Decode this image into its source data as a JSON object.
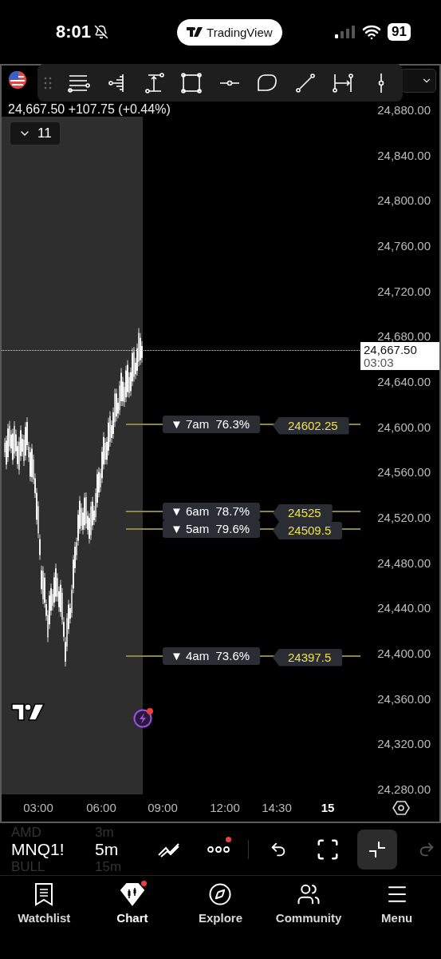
{
  "status_bar": {
    "time": "8:01",
    "app_pill": "TradingView",
    "battery": "91"
  },
  "quote": "24,667.50 +107.75 (+0.44%)",
  "indicators_toggle": {
    "count": "11",
    "expanded": false
  },
  "price_axis": {
    "labels": [
      "24,880.00",
      "24,840.00",
      "24,800.00",
      "24,760.00",
      "24,720.00",
      "24,680.00",
      "24,640.00",
      "24,600.00",
      "24,560.00",
      "24,520.00",
      "24,480.00",
      "24,440.00",
      "24,400.00",
      "24,360.00",
      "24,320.00",
      "24,280.00"
    ],
    "current_price": "24,667.50",
    "countdown": "03:03"
  },
  "levels": [
    {
      "marker": "▼",
      "session": "7am",
      "percent": "76.3%",
      "price": "24602.25"
    },
    {
      "marker": "▼",
      "session": "6am",
      "percent": "78.7%",
      "price": "24525"
    },
    {
      "marker": "▼",
      "session": "5am",
      "percent": "79.6%",
      "price": "24509.5"
    },
    {
      "marker": "▼",
      "session": "4am",
      "percent": "73.6%",
      "price": "24397.5"
    }
  ],
  "time_axis": [
    {
      "label": "03:00",
      "kind": "time"
    },
    {
      "label": "06:00",
      "kind": "time"
    },
    {
      "label": "09:00",
      "kind": "time"
    },
    {
      "label": "12:00",
      "kind": "time"
    },
    {
      "label": "14:30",
      "kind": "time"
    },
    {
      "label": "15",
      "kind": "day"
    }
  ],
  "symbol_picker": [
    {
      "symbol": "AMD",
      "interval": "3m",
      "selected": false
    },
    {
      "symbol": "MNQ1!",
      "interval": "5m",
      "selected": true
    },
    {
      "symbol": "BULL",
      "interval": "15m",
      "selected": false
    }
  ],
  "actions": [
    {
      "kind": "style",
      "disabled": false,
      "badge": false
    },
    {
      "kind": "more",
      "disabled": false,
      "badge": true
    },
    {
      "kind": "undo",
      "disabled": false,
      "badge": false
    },
    {
      "kind": "fullscreen",
      "disabled": false,
      "badge": false
    },
    {
      "kind": "minimize",
      "disabled": false,
      "badge": false
    },
    {
      "kind": "redo",
      "disabled": true,
      "badge": false
    }
  ],
  "nav": [
    {
      "kind": "watchlist",
      "label": "Watchlist",
      "selected": false
    },
    {
      "kind": "chart",
      "label": "Chart",
      "selected": true
    },
    {
      "kind": "explore",
      "label": "Explore",
      "selected": false
    },
    {
      "kind": "community",
      "label": "Community",
      "selected": false
    },
    {
      "kind": "menu",
      "label": "Menu",
      "selected": false
    }
  ]
}
